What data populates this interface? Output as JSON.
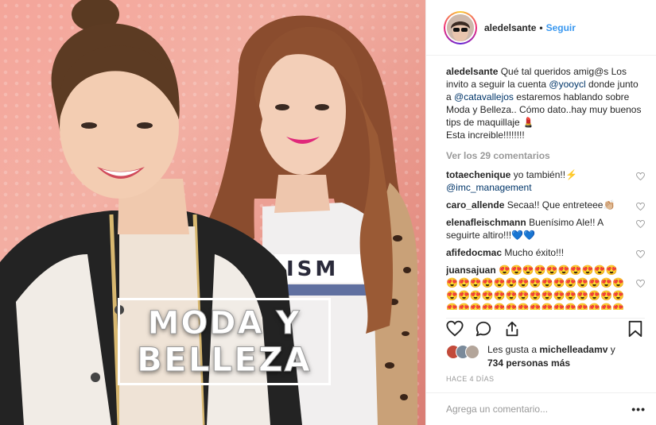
{
  "post": {
    "image_title_line1": "MODA Y",
    "image_title_line2": "BELLEZA"
  },
  "header": {
    "username": "aledelsante",
    "separator": "•",
    "follow_label": "Seguir"
  },
  "caption": {
    "username": "aledelsante",
    "text_1": "Qué tal queridos amig@s Los invito a seguir la cuenta",
    "mention_1": "@yooycl",
    "text_2": "donde junto a",
    "mention_2": "@catavallejos",
    "text_3": "estaremos hablando sobre Moda y Belleza.. Cómo dato..hay muy buenos tips de maquillaje",
    "emoji_1": "💄",
    "text_4": "Esta increible!!!!!!!!"
  },
  "view_all_label": "Ver los 29 comentarios",
  "comments": [
    {
      "username": "totaechenique",
      "text": "yo también!!⚡",
      "mention": "@imc_management"
    },
    {
      "username": "caro_allende",
      "text": "Secaa!! Que entreteee👏🏼",
      "mention": ""
    },
    {
      "username": "elenafleischmann",
      "text": "Buenísimo Ale!! A seguirte altiro!!!💙💙",
      "mention": ""
    },
    {
      "username": "afifedocmac",
      "text": "Mucho éxito!!!",
      "mention": ""
    },
    {
      "username": "juansajuan",
      "text": "😍😍😍😍😍😍😍😍😍😍😍😍😍😍😍😍😍😍😍😍😍😍😍😍😍😍😍😍😍😍😍😍😍😍😍😍😍😍😍😍😍😍😍😍😍😍😍😍😍😍😍😍😍😍😍😍",
      "mention": ""
    }
  ],
  "likes": {
    "prefix": "Les gusta a",
    "user": "michelleadamv",
    "conj": "y",
    "others": "734 personas más"
  },
  "timestamp": "HACE 4 DÍAS",
  "add_comment": {
    "placeholder": "Agrega un comentario...",
    "more_label": "•••"
  },
  "icons": {
    "like": "heart-icon",
    "comment": "comment-bubble-icon",
    "share": "share-icon",
    "save": "bookmark-icon"
  },
  "colors": {
    "link": "#3897f0",
    "mention": "#003569",
    "muted": "#999999",
    "text": "#262626",
    "background_pink": "#f4a59a"
  }
}
